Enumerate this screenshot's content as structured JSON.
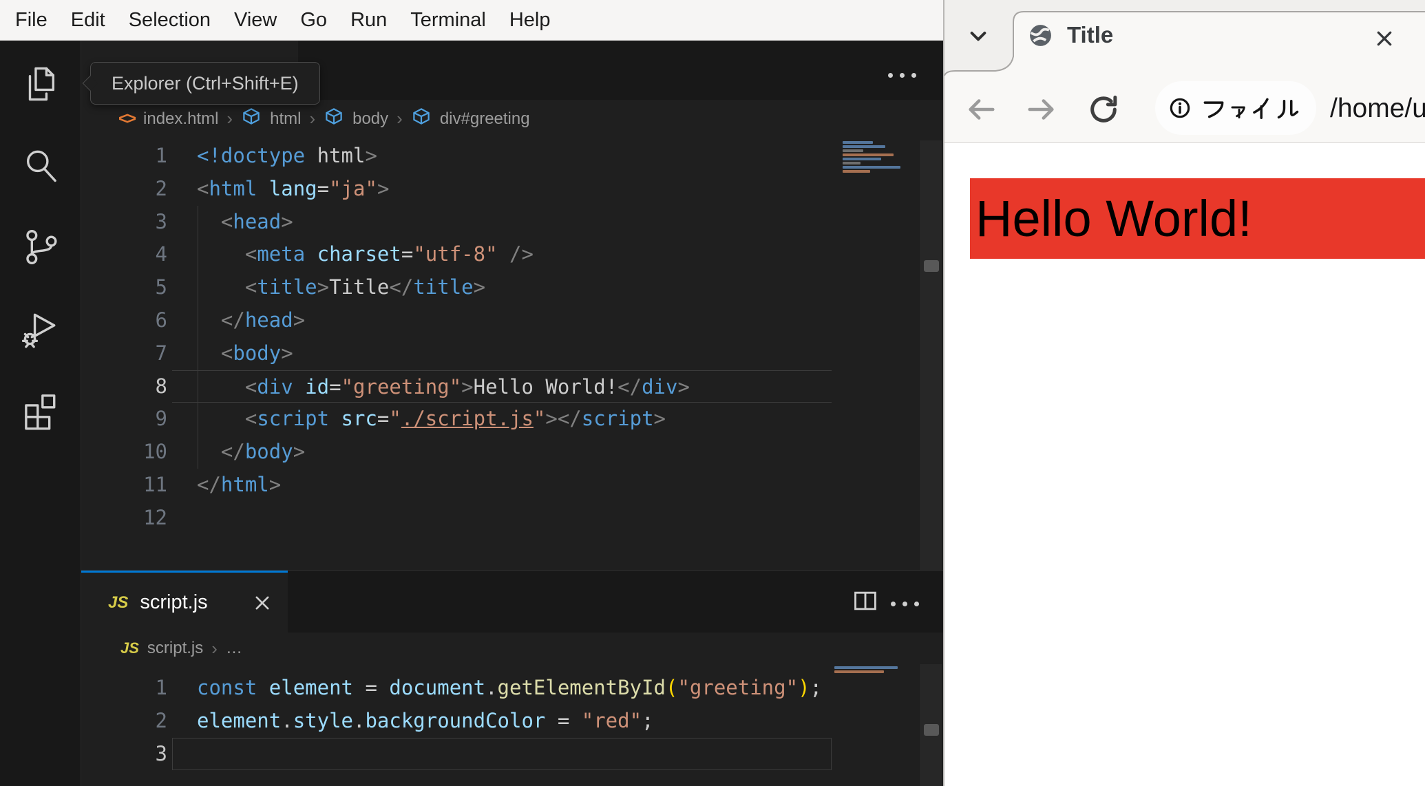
{
  "app": {
    "menu": [
      "File",
      "Edit",
      "Selection",
      "View",
      "Go",
      "Run",
      "Terminal",
      "Help"
    ]
  },
  "activity": {
    "tooltip": "Explorer (Ctrl+Shift+E)",
    "icons": [
      "explorer",
      "search",
      "source-control",
      "run-and-debug",
      "extensions"
    ]
  },
  "html_editor": {
    "breadcrumb": {
      "file": "index.html",
      "segments": [
        "html",
        "body",
        "div#greeting"
      ]
    },
    "active_line": 8,
    "lines": [
      {
        "n": "1",
        "t": [
          [
            "tag",
            "<!doctype"
          ],
          [
            "fg",
            " html"
          ],
          [
            "pu",
            ">"
          ]
        ]
      },
      {
        "n": "2",
        "t": [
          [
            "pu",
            "<"
          ],
          [
            "tag",
            "html"
          ],
          [
            "at",
            " lang"
          ],
          [
            "fg",
            "="
          ],
          [
            "st",
            "\"ja\""
          ],
          [
            "pu",
            ">"
          ]
        ]
      },
      {
        "n": "3",
        "t": [
          [
            "fg",
            "  "
          ],
          [
            "pu",
            "<"
          ],
          [
            "tag",
            "head"
          ],
          [
            "pu",
            ">"
          ]
        ]
      },
      {
        "n": "4",
        "t": [
          [
            "fg",
            "    "
          ],
          [
            "pu",
            "<"
          ],
          [
            "tag",
            "meta"
          ],
          [
            "at",
            " charset"
          ],
          [
            "fg",
            "="
          ],
          [
            "st",
            "\"utf-8\""
          ],
          [
            "pu",
            " />"
          ]
        ]
      },
      {
        "n": "5",
        "t": [
          [
            "fg",
            "    "
          ],
          [
            "pu",
            "<"
          ],
          [
            "tag",
            "title"
          ],
          [
            "pu",
            ">"
          ],
          [
            "fg",
            "Title"
          ],
          [
            "pu",
            "</"
          ],
          [
            "tag",
            "title"
          ],
          [
            "pu",
            ">"
          ]
        ]
      },
      {
        "n": "6",
        "t": [
          [
            "fg",
            "  "
          ],
          [
            "pu",
            "</"
          ],
          [
            "tag",
            "head"
          ],
          [
            "pu",
            ">"
          ]
        ]
      },
      {
        "n": "7",
        "t": [
          [
            "fg",
            "  "
          ],
          [
            "pu",
            "<"
          ],
          [
            "tag",
            "body"
          ],
          [
            "pu",
            ">"
          ]
        ]
      },
      {
        "n": "8",
        "t": [
          [
            "fg",
            "    "
          ],
          [
            "pu",
            "<"
          ],
          [
            "tag",
            "div"
          ],
          [
            "at",
            " id"
          ],
          [
            "fg",
            "="
          ],
          [
            "st",
            "\"greeting\""
          ],
          [
            "pu",
            ">"
          ],
          [
            "fg",
            "Hello World!"
          ],
          [
            "pu",
            "</"
          ],
          [
            "tag",
            "div"
          ],
          [
            "pu",
            ">"
          ]
        ]
      },
      {
        "n": "9",
        "t": [
          [
            "fg",
            "    "
          ],
          [
            "pu",
            "<"
          ],
          [
            "tag",
            "script"
          ],
          [
            "at",
            " src"
          ],
          [
            "fg",
            "="
          ],
          [
            "st",
            "\""
          ],
          [
            "lk",
            "./script.js"
          ],
          [
            "st",
            "\""
          ],
          [
            "pu",
            "></"
          ],
          [
            "tag",
            "script"
          ],
          [
            "pu",
            ">"
          ]
        ]
      },
      {
        "n": "10",
        "t": [
          [
            "fg",
            "  "
          ],
          [
            "pu",
            "</"
          ],
          [
            "tag",
            "body"
          ],
          [
            "pu",
            ">"
          ]
        ]
      },
      {
        "n": "11",
        "t": [
          [
            "pu",
            "</"
          ],
          [
            "tag",
            "html"
          ],
          [
            "pu",
            ">"
          ]
        ]
      },
      {
        "n": "12",
        "t": []
      }
    ]
  },
  "js_editor": {
    "tab_label": "script.js",
    "breadcrumb_file": "script.js",
    "breadcrumb_more": "…",
    "active_line": 3,
    "lines": [
      {
        "n": "1",
        "t": [
          [
            "kw",
            "const"
          ],
          [
            "vr",
            " element"
          ],
          [
            "fg",
            " = "
          ],
          [
            "vr",
            "document"
          ],
          [
            "fg",
            "."
          ],
          [
            "fn",
            "getElementById"
          ],
          [
            "pr",
            "("
          ],
          [
            "st",
            "\"greeting\""
          ],
          [
            "pr",
            ")"
          ],
          [
            "fg",
            ";"
          ]
        ]
      },
      {
        "n": "2",
        "t": [
          [
            "vr",
            "element"
          ],
          [
            "fg",
            "."
          ],
          [
            "vr",
            "style"
          ],
          [
            "fg",
            "."
          ],
          [
            "vr",
            "backgroundColor"
          ],
          [
            "fg",
            " = "
          ],
          [
            "st",
            "\"red\""
          ],
          [
            "fg",
            ";"
          ]
        ]
      },
      {
        "n": "3",
        "t": []
      }
    ]
  },
  "browser": {
    "tab_title": "Title",
    "address_chip_label": "ファイル",
    "url_text": "/home/u",
    "page": {
      "greeting_text": "Hello World!",
      "greeting_background": "#e8382a"
    }
  },
  "colors": {
    "accent_blue": "#0078d4",
    "red_block": "#e8382a"
  }
}
